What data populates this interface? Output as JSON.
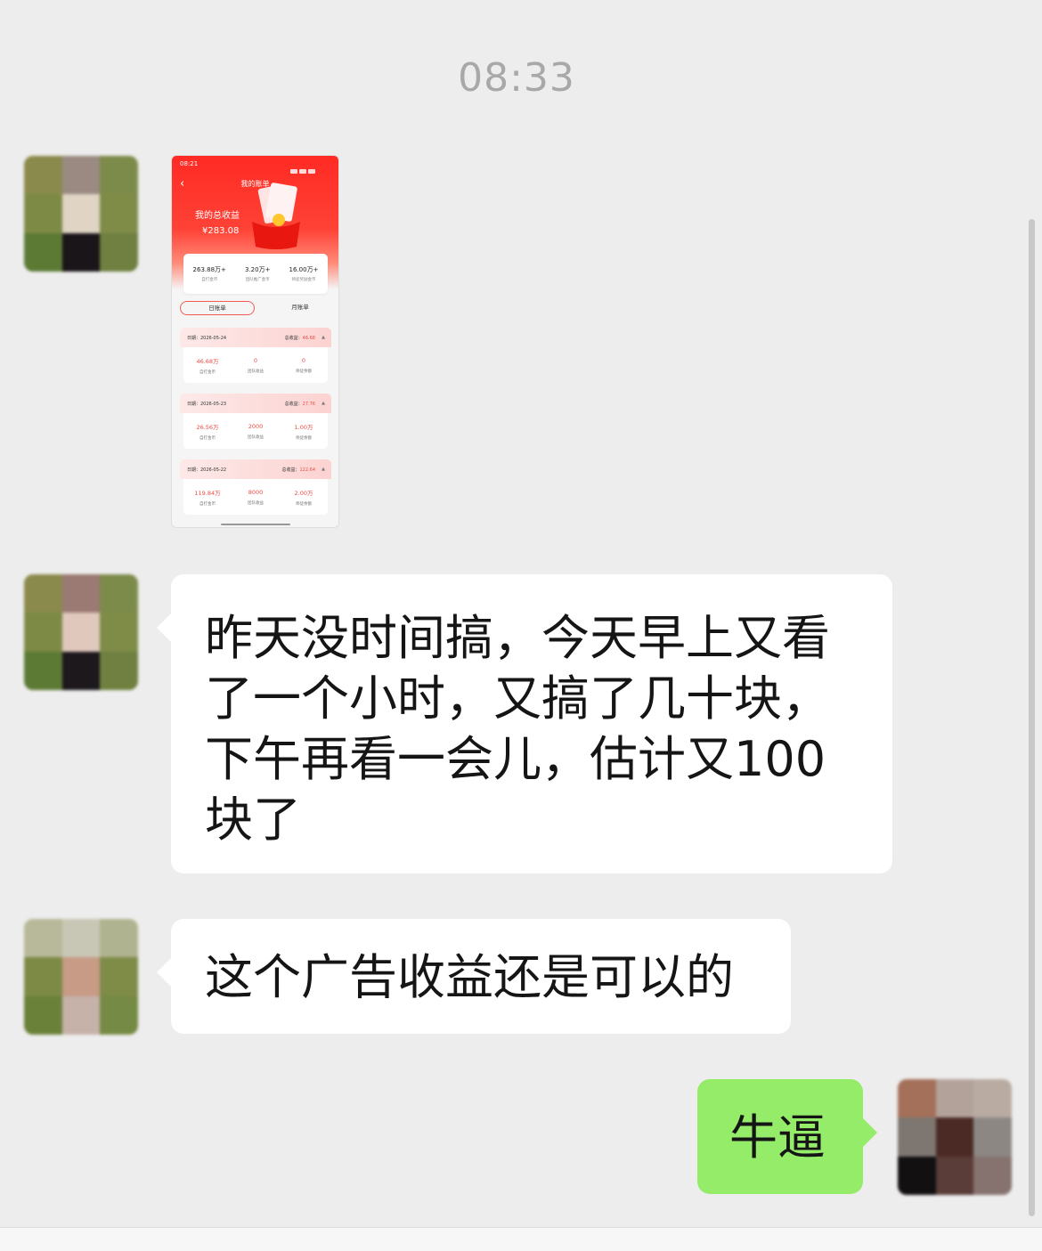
{
  "timestamp": "08:33",
  "colors": {
    "background": "#ededed",
    "bubble_other": "#ffffff",
    "bubble_me": "#95ec69",
    "timestamp_text": "#a8a8a8"
  },
  "messages": [
    {
      "sender": "other",
      "type": "image"
    },
    {
      "sender": "other",
      "type": "text",
      "lines": [
        "昨天没时间搞，今天早上又看",
        "了一个小时，又搞了几十块，",
        "下午再看一会儿，估计又100",
        "块了"
      ]
    },
    {
      "sender": "other",
      "type": "text",
      "text": "这个广告收益还是可以的"
    },
    {
      "sender": "me",
      "type": "text",
      "text": "牛逼"
    }
  ],
  "shared_image": {
    "status_time": "08:21",
    "back_icon": "chevron-left-icon",
    "title": "我的账单",
    "earnings_label": "我的总收益",
    "earnings_value": "¥283.08",
    "stats": [
      {
        "value": "263.88万+",
        "label": "自打金币"
      },
      {
        "value": "3.20万+",
        "label": "团队推广金币"
      },
      {
        "value": "16.00万+",
        "label": "师徒奖励金币"
      }
    ],
    "tabs": [
      "日账单",
      "月账单"
    ],
    "entries": [
      {
        "date": "日期：2026-05-24",
        "total_label": "总收益：",
        "total": "46.68",
        "cells": [
          {
            "value": "46.68万",
            "label": "自打金币"
          },
          {
            "value": "0",
            "label": "团队收益"
          },
          {
            "value": "0",
            "label": "师徒余额"
          }
        ]
      },
      {
        "date": "日期：2026-05-23",
        "total_label": "总收益：",
        "total": "27.76",
        "cells": [
          {
            "value": "26.56万",
            "label": "自打金币"
          },
          {
            "value": "2000",
            "label": "团队收益"
          },
          {
            "value": "1.00万",
            "label": "师徒余额"
          }
        ]
      },
      {
        "date": "日期：2026-05-22",
        "total_label": "总收益：",
        "total": "122.64",
        "cells": [
          {
            "value": "119.84万",
            "label": "自打金币"
          },
          {
            "value": "8000",
            "label": "团队收益"
          },
          {
            "value": "2.00万",
            "label": "师徒余额"
          }
        ]
      }
    ]
  }
}
